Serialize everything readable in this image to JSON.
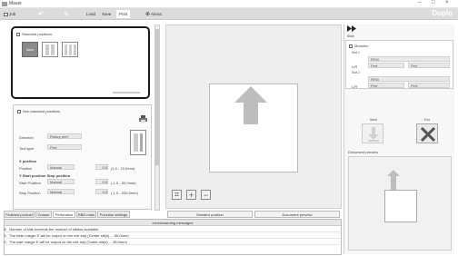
{
  "window": {
    "title": "Maxer",
    "controls": [
      "–",
      "□",
      "×"
    ]
  },
  "toolbar": {
    "items": [
      {
        "label": "Job",
        "icon": "job-icon"
      },
      {
        "label": "Undo",
        "icon": "undo-icon"
      },
      {
        "label": "Edit",
        "icon": "edit-icon"
      },
      {
        "label": "Load",
        "icon": "load-icon"
      },
      {
        "label": "Save",
        "icon": "save-icon"
      },
      {
        "label": "Print",
        "icon": "print-icon"
      },
      {
        "label": "About",
        "icon": "about-icon"
      }
    ],
    "brand": "Duplo"
  },
  "standard_positions": {
    "title": "Standard positions",
    "options": [
      "None",
      "Type A",
      "Type B"
    ]
  },
  "nonstandard": {
    "title": "Non-standard positions",
    "direction_label": "Direction",
    "direction_value": "Rotary perf.",
    "tool_type_label": "Tool type",
    "tool_type_value": "Perf.",
    "x_position_label": "X position",
    "position_label": "Position",
    "position_mode": "Manual",
    "position_value": "0.0",
    "position_range": "(1.0 - 15.0mm)",
    "y_start_label": "Y Start position Stop position",
    "start_label": "Start Position",
    "start_mode": "Manual",
    "start_value": "0.0",
    "start_range": "(-1.0 - 30.0mm)",
    "stop_label": "Stop Position",
    "stop_mode": "Manual",
    "stop_value": "0.0",
    "stop_range": "(-1.0 - 330.0mm)"
  },
  "tabs": [
    "Finished product",
    "Crease",
    "Perforation",
    "RBD mark",
    "Function settings"
  ],
  "active_tab": "Perforation",
  "bottom_buttons": {
    "detailed": "Detailed position",
    "preview": "Document preview"
  },
  "messages": {
    "title": "errors/warning messages",
    "rows": [
      "Number of slits exceeds the number of slitters available.",
      "The slide margin E will be output on the exit tray (Center slit(s) ... 55.0mm)",
      "The side margin E will be output on the exit tray (Gutter slit(s) ... 36.0mm)"
    ]
  },
  "right": {
    "slide_label": "Slide",
    "modules_label": "Modules",
    "slot1": {
      "label": "Slot 1",
      "type": "RFM",
      "lr": "L/R",
      "left": "Perf.",
      "right": "Perf."
    },
    "slot2": {
      "label": "Slot 2",
      "type": "RFM",
      "lr": "L/R",
      "left": "Perf.",
      "right": "Perf."
    },
    "save_label": "Save",
    "exit_label": "Exit",
    "doc_preview_label": "Document preview"
  }
}
